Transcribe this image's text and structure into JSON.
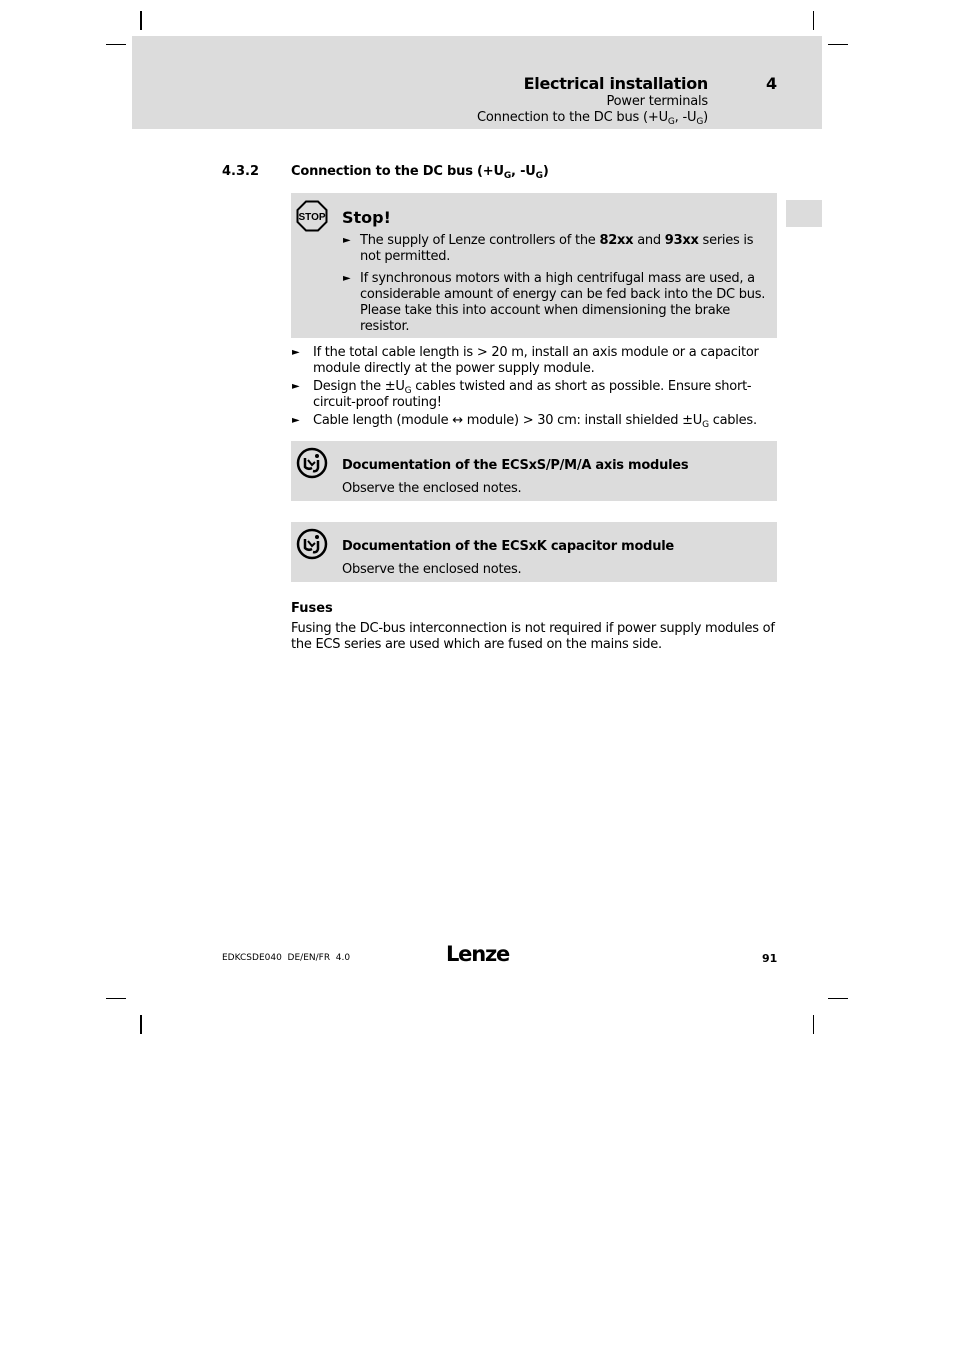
{
  "header": {
    "title": "Electrical installation",
    "chapter_number": "4",
    "subtitle_1": "Power terminals",
    "subtitle_2_prefix": "Connection to the DC bus (+U",
    "subtitle_2_sub1": "G",
    "subtitle_2_mid": ", -U",
    "subtitle_2_sub2": "G",
    "subtitle_2_suffix": ")"
  },
  "section": {
    "number": "4.3.2",
    "title_prefix": "Connection to the DC bus (+U",
    "title_sub1": "G",
    "title_mid": ", -U",
    "title_sub2": "G",
    "title_suffix": ")"
  },
  "stop_box": {
    "icon": "stop-sign-icon",
    "icon_text": "STOP",
    "title": "Stop!",
    "items": [
      {
        "p1": "The supply of Lenze controllers of the ",
        "b1": "82xx",
        "p2": " and ",
        "b2": "93xx",
        "p3": " series is not permitted."
      },
      {
        "text": "If synchronous motors with a high centrifugal mass are used, a considerable amount of energy can be fed back into the DC bus. Please take this into account when dimensioning the brake resistor."
      }
    ]
  },
  "bullets": [
    {
      "text": "If the total cable length is > 20 m, install an axis module or a capacitor module directly at the power supply module."
    },
    {
      "prefix": "Design the ±U",
      "sub": "G",
      "suffix": " cables twisted and as short as possible. Ensure short-circuit-proof routing!"
    },
    {
      "prefix": "Cable length (module ↔ module) > 30 cm: install shielded ±U",
      "sub": "G",
      "suffix": " cables."
    }
  ],
  "bullet_glyph": "►",
  "doc_notes": [
    {
      "icon": "documentation-reference-icon",
      "title": "Documentation of the ECSxS/P/M/A axis modules",
      "text": "Observe the enclosed notes."
    },
    {
      "icon": "documentation-reference-icon",
      "title": "Documentation of the ECSxK capacitor module",
      "text": "Observe the enclosed notes."
    }
  ],
  "fuses": {
    "heading": "Fuses",
    "text": "Fusing the DC-bus interconnection is not required if power supply modules of the ECS series are used which are fused on the mains side."
  },
  "footer": {
    "doc_id": "EDKCSDE040  DE/EN/FR  4.0",
    "logo": "Lenze",
    "page_number": "91"
  }
}
